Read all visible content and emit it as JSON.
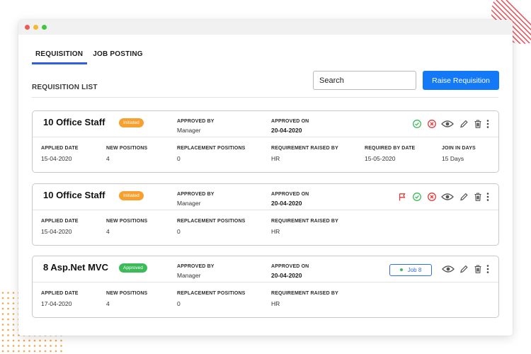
{
  "tabs": [
    "REQUISITION",
    "JOB POSTING"
  ],
  "list_title": "REQUISITION LIST",
  "search": {
    "placeholder": "Search"
  },
  "raise_button": "Raise Requisition",
  "labels": {
    "approved_by": "APPROVED BY",
    "approved_on": "APPROVED ON",
    "applied_date": "APPLIED DATE",
    "new_positions": "NEW POSITIONS",
    "replacement_positions": "REPLACEMENT POSITIONS",
    "requirement_raised_by": "REQUIREMENT RAISED BY",
    "required_by_date": "REQUIRED BY DATE",
    "join_in_days": "JOIN IN DAYS"
  },
  "cards": [
    {
      "title": "10 Office Staff",
      "status": "Initiated",
      "approved_by": "Manager",
      "approved_on": "20-04-2020",
      "applied_date": "15-04-2020",
      "new_positions": "4",
      "replacement_positions": "0",
      "requirement_raised_by": "HR",
      "required_by_date": "15-05-2020",
      "join_in_days": "15 Days",
      "icons": [
        "check-circle-icon",
        "x-circle-icon",
        "eye-icon",
        "pencil-icon",
        "trash-icon",
        "more-vertical-icon"
      ]
    },
    {
      "title": "10 Office Staff",
      "status": "Initiated",
      "approved_by": "Manager",
      "approved_on": "20-04-2020",
      "applied_date": "15-04-2020",
      "new_positions": "4",
      "replacement_positions": "0",
      "requirement_raised_by": "HR",
      "icons": [
        "flag-icon",
        "check-circle-icon",
        "x-circle-icon",
        "eye-icon",
        "pencil-icon",
        "trash-icon",
        "more-vertical-icon"
      ]
    },
    {
      "title": "8 Asp.Net MVC",
      "status": "Approved",
      "approved_by": "Manager",
      "approved_on": "20-04-2020",
      "applied_date": "17-04-2020",
      "new_positions": "4",
      "replacement_positions": "0",
      "requirement_raised_by": "HR",
      "job_link": "Job 8",
      "icons": [
        "eye-icon",
        "pencil-icon",
        "trash-icon",
        "more-vertical-icon"
      ]
    }
  ],
  "colors": {
    "accent": "#1479f6",
    "tab_underline": "#2f5fe0",
    "initiated": "#f7a030",
    "approved": "#3dbb5a",
    "reject": "#e03a3a",
    "decor": "#e8474f"
  }
}
